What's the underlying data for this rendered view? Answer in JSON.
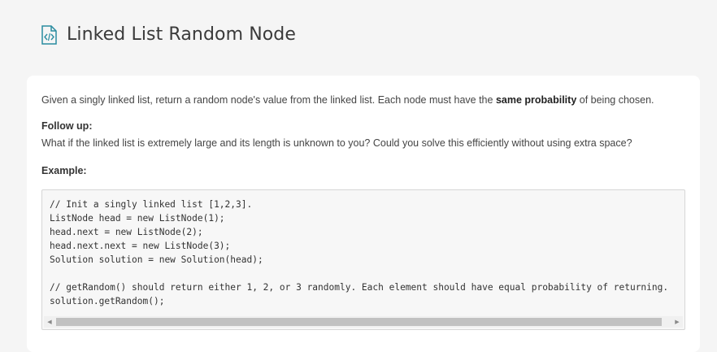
{
  "header": {
    "title": "Linked List Random Node",
    "icon": "code-file-icon"
  },
  "description": {
    "before": "Given a singly linked list, return a random node's value from the linked list. Each node must have the ",
    "emphasis": "same probability",
    "after": " of being chosen."
  },
  "follow_up": {
    "heading": "Follow up:",
    "text": "What if the linked list is extremely large and its length is unknown to you? Could you solve this efficiently without using extra space?"
  },
  "example": {
    "heading": "Example:",
    "code": "// Init a singly linked list [1,2,3].\nListNode head = new ListNode(1);\nhead.next = new ListNode(2);\nhead.next.next = new ListNode(3);\nSolution solution = new Solution(head);\n\n// getRandom() should return either 1, 2, or 3 randomly. Each element should have equal probability of returning.\nsolution.getRandom();"
  },
  "scrollbar": {
    "left_arrow": "◀",
    "right_arrow": "▶"
  },
  "colors": {
    "accent": "#2a8ca0",
    "background": "#f5f5f5",
    "card": "#ffffff"
  }
}
